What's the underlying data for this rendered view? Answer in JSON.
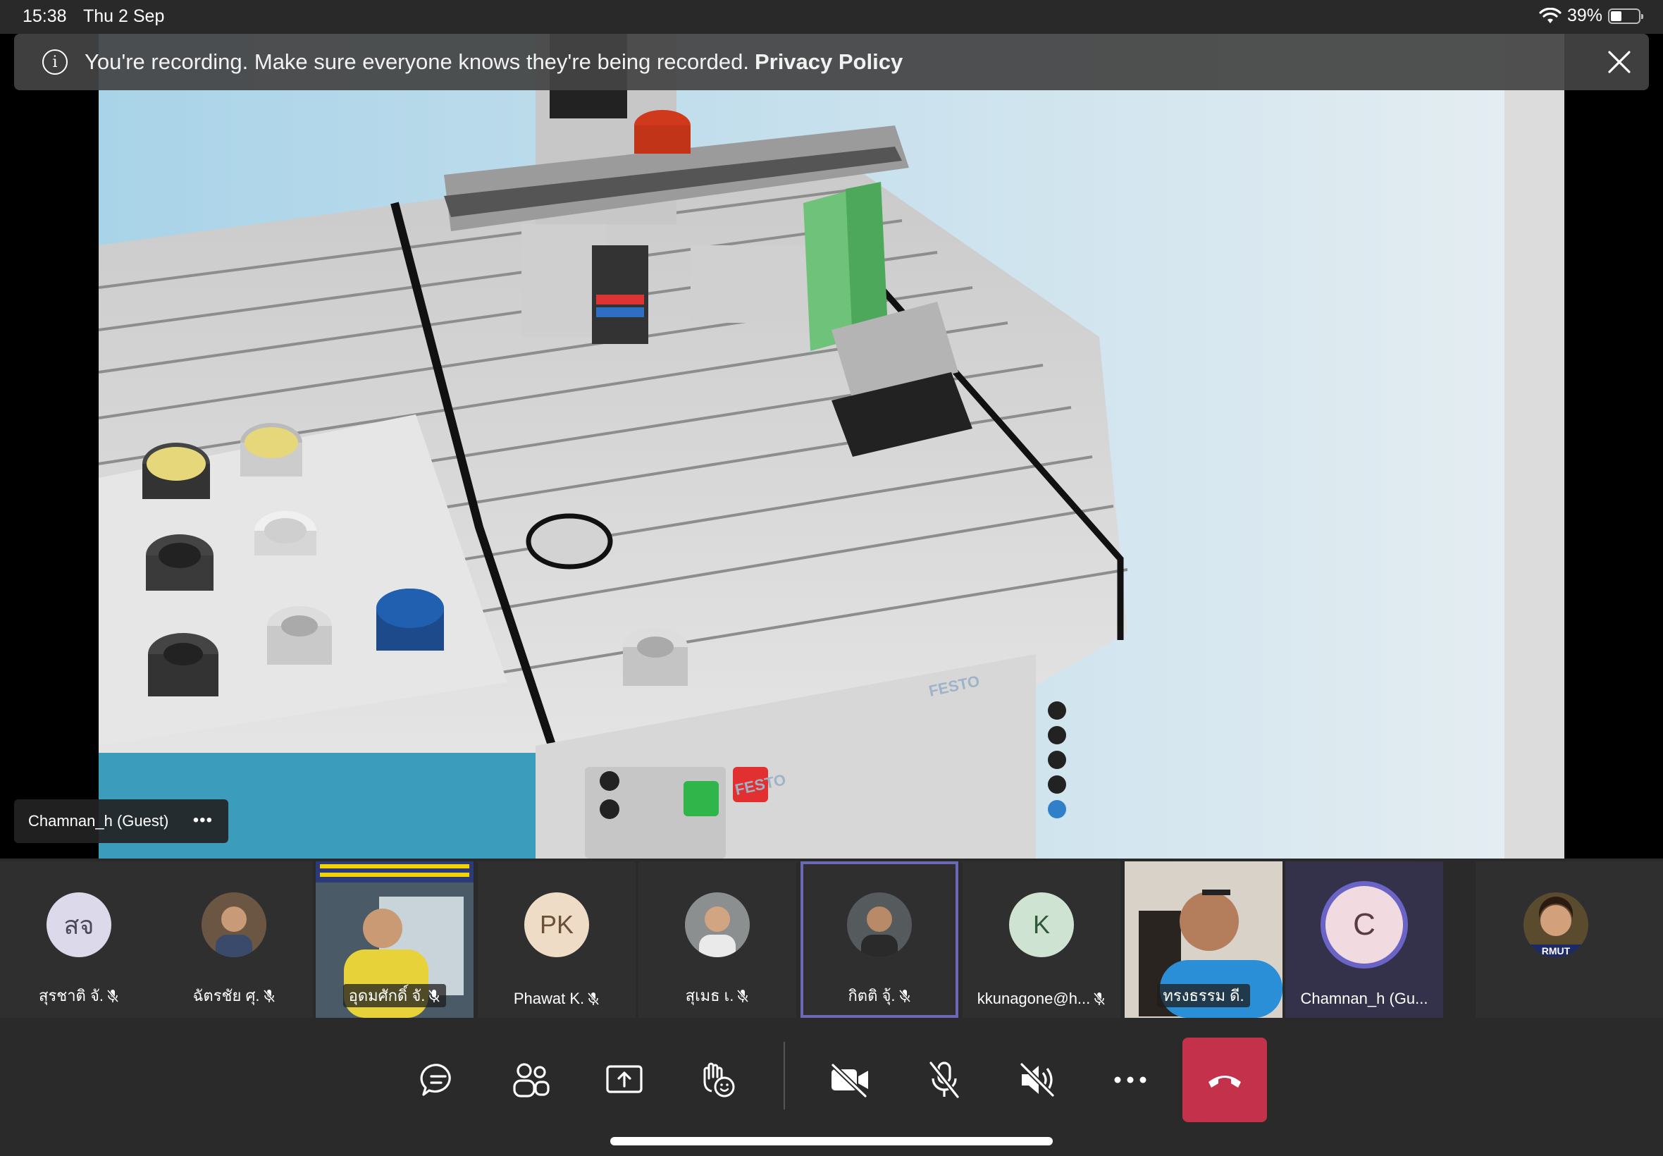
{
  "status_bar": {
    "time": "15:38",
    "date": "Thu 2 Sep",
    "battery": "39%",
    "battery_level": 0.39
  },
  "banner": {
    "message": "You're recording. Make sure everyone knows they're being recorded.",
    "link": "Privacy Policy"
  },
  "presenter": {
    "name": "Chamnan_h (Guest)",
    "more": "•••"
  },
  "share_content": {
    "brand_text": "FESTO"
  },
  "participants": [
    {
      "name": "สุรชาติ จั.",
      "initials": "สจ",
      "type": "initials",
      "avatar_color": "#dcdaea",
      "muted": true
    },
    {
      "name": "ฉัตรชัย ศุ.",
      "initials": "",
      "type": "photo",
      "muted": true
    },
    {
      "name": "อุดมศักดิ์ จั.",
      "initials": "",
      "type": "video",
      "muted": true
    },
    {
      "name": "Phawat K.",
      "initials": "PK",
      "type": "initials",
      "avatar_color": "#efdcc6",
      "muted": true
    },
    {
      "name": "สุเมธ เ.",
      "initials": "",
      "type": "photo",
      "muted": true
    },
    {
      "name": "กิตติ จุ้.",
      "initials": "",
      "type": "photo",
      "muted": true,
      "active": true
    },
    {
      "name": "kkunagone@h...",
      "initials": "K",
      "type": "initials",
      "avatar_color": "#cfe3d3",
      "muted": true
    },
    {
      "name": "ทรงธรรม ดี.",
      "initials": "",
      "type": "video",
      "muted": false
    },
    {
      "name": "Chamnan_h (Gu...",
      "initials": "C",
      "type": "guest",
      "muted": false
    },
    {
      "name": "",
      "initials": "",
      "type": "photo",
      "muted": false,
      "badge": "RMUT"
    }
  ],
  "toolbar": {
    "buttons": [
      "chat-icon",
      "participants-icon",
      "share-icon",
      "raise-hand-icon",
      "camera-off-icon",
      "mic-off-icon",
      "speaker-off-icon",
      "more-icon",
      "hang-up-icon"
    ],
    "hangup_color": "#c4314b"
  }
}
